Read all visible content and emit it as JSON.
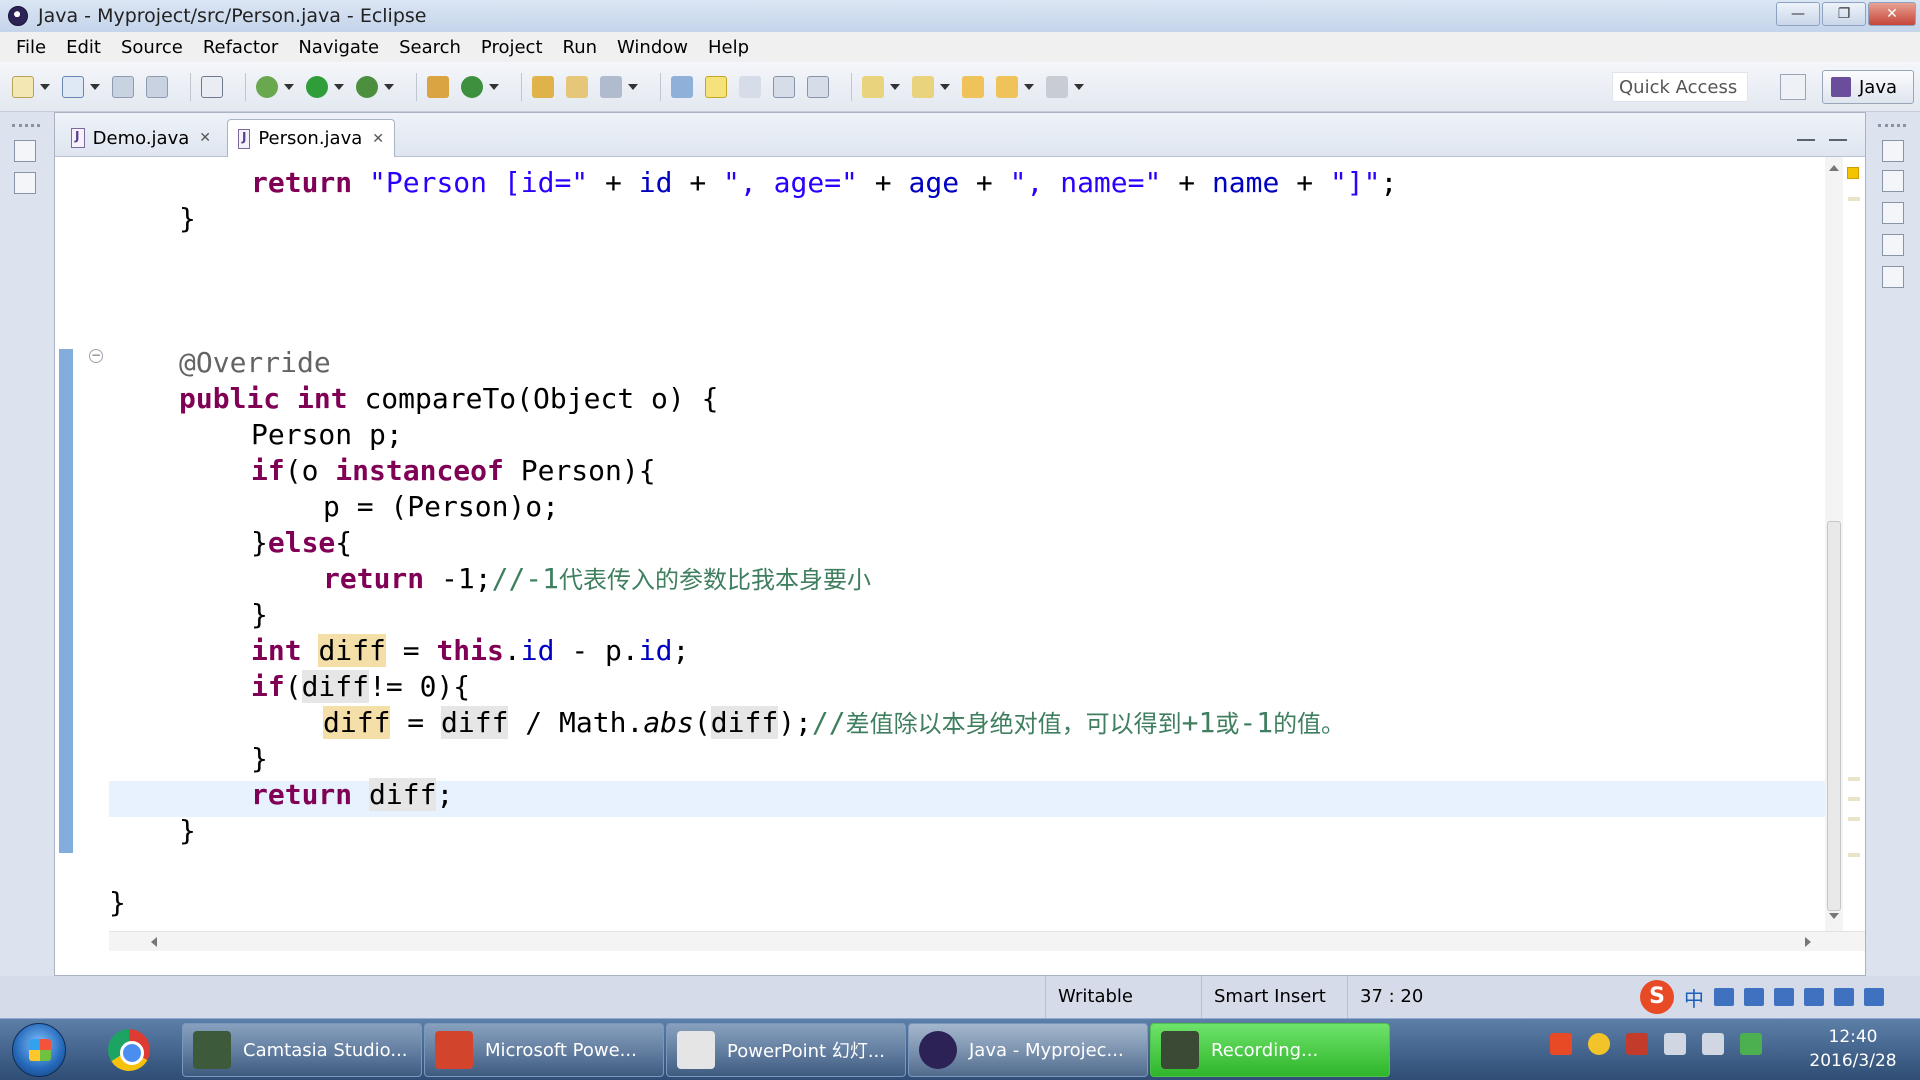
{
  "window": {
    "title": "Java - Myproject/src/Person.java - Eclipse"
  },
  "menu": [
    "File",
    "Edit",
    "Source",
    "Refactor",
    "Navigate",
    "Search",
    "Project",
    "Run",
    "Window",
    "Help"
  ],
  "toolbar": {
    "quick_access": "Quick Access",
    "perspective": "Java"
  },
  "tabs": [
    {
      "label": "Demo.java",
      "active": false
    },
    {
      "label": "Person.java",
      "active": true
    }
  ],
  "code": {
    "l1_ret": "return",
    "l1_s1": "\"Person [id=\"",
    "l1_p1": " + ",
    "l1_f1": "id",
    "l1_p2": " + ",
    "l1_s2": "\", age=\"",
    "l1_p3": " + ",
    "l1_f2": "age",
    "l1_p4": " + ",
    "l1_s3": "\", name=\"",
    "l1_p5": " + ",
    "l1_f3": "name",
    "l1_p6": " + ",
    "l1_s4": "\"]\"",
    "l1_end": ";",
    "l2": "}",
    "ann": "@Override",
    "m_public": "public",
    "m_int": "int",
    "m_rest": " compareTo(Object o) {",
    "p_decl": "Person p;",
    "if_kw": "if",
    "if_open": "(o ",
    "inst_kw": "instanceof",
    "if_rest": " Person){",
    "assign": "p = (Person)o;",
    "else_open": "}",
    "else_kw": "else",
    "else_brace": "{",
    "ret_kw": "return",
    "ret_neg": " -1;",
    "cmt1_a": "//-1",
    "cmt1_b": "代表传入的参数比我本身要小",
    "close1": "}",
    "int_kw": "int",
    "diff": "diff",
    "eq": " = ",
    "this_kw": "this",
    "dot_id": ".",
    "fld_id": "id",
    "minus": " - p.",
    "semi": ";",
    "if2_open": "(",
    "if2_rest": "!= 0){",
    "div": " / Math.",
    "abs": "abs",
    "paren_open": "(",
    "paren_close": ");",
    "cmt2_a": "//",
    "cmt2_b": "差值除以本身绝对值，可以得到",
    "cmt2_c": "+1",
    "cmt2_d": "或",
    "cmt2_e": "-1",
    "cmt2_f": "的值。",
    "close2": "}",
    "return_kw": "return",
    "close3": "}",
    "close4": "}"
  },
  "status": {
    "writable": "Writable",
    "insert_mode": "Smart Insert",
    "position": "37 : 20"
  },
  "ime": {
    "lang": "中"
  },
  "taskbar": {
    "items": [
      {
        "label": "Camtasia Studio...",
        "color": "#3d5a3a"
      },
      {
        "label": "Microsoft Powe...",
        "color": "#d2452c"
      },
      {
        "label": "PowerPoint 幻灯...",
        "color": "#e5e5e5"
      },
      {
        "label": "Java - Myprojec...",
        "color": "#2c2255"
      },
      {
        "label": "Recording...",
        "color": "#3b4a35"
      }
    ],
    "time": "12:40",
    "date": "2016/3/28"
  }
}
